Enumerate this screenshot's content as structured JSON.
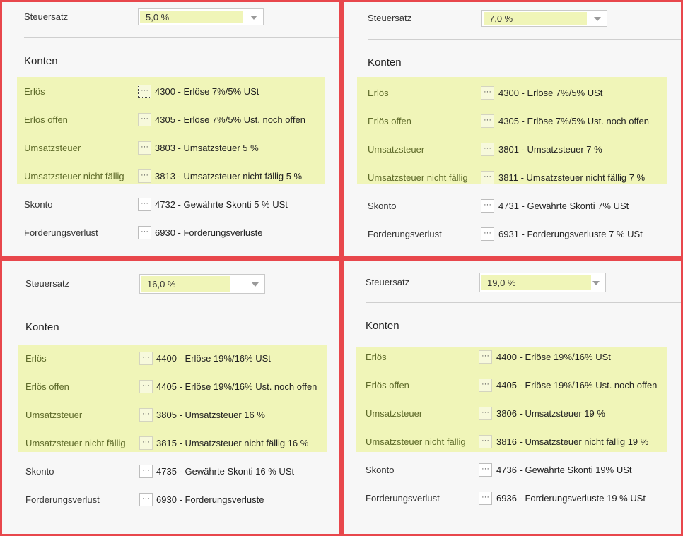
{
  "panels": [
    {
      "tax_label": "Steuersatz",
      "tax_rate": "5,0 %",
      "section_title": "Konten",
      "rows": [
        {
          "label": "Erlös",
          "account": "4300 - Erlöse 7%/5% USt"
        },
        {
          "label": "Erlös offen",
          "account": "4305 - Erlöse 7%/5% Ust. noch offen"
        },
        {
          "label": "Umsatzsteuer",
          "account": "3803 - Umsatzsteuer 5 %"
        },
        {
          "label": "Umsatzsteuer nicht fällig",
          "account": "3813 - Umsatzsteuer nicht fällig 5 %"
        },
        {
          "label": "Skonto",
          "account": "4732 - Gewährte Skonti 5 % USt"
        },
        {
          "label": "Forderungsverlust",
          "account": "6930 - Forderungsverluste"
        }
      ]
    },
    {
      "tax_label": "Steuersatz",
      "tax_rate": "7,0 %",
      "section_title": "Konten",
      "rows": [
        {
          "label": "Erlös",
          "account": "4300 - Erlöse 7%/5% USt"
        },
        {
          "label": "Erlös offen",
          "account": "4305 - Erlöse 7%/5% Ust. noch offen"
        },
        {
          "label": "Umsatzsteuer",
          "account": "3801 - Umsatzsteuer 7 %"
        },
        {
          "label": "Umsatzsteuer nicht fällig",
          "account": "3811 - Umsatzsteuer nicht fällig 7 %"
        },
        {
          "label": "Skonto",
          "account": "4731 - Gewährte Skonti 7% USt"
        },
        {
          "label": "Forderungsverlust",
          "account": "6931 - Forderungsverluste 7 % USt"
        }
      ]
    },
    {
      "tax_label": "Steuersatz",
      "tax_rate": "16,0 %",
      "section_title": "Konten",
      "rows": [
        {
          "label": "Erlös",
          "account": "4400 - Erlöse 19%/16% USt"
        },
        {
          "label": "Erlös offen",
          "account": "4405 - Erlöse 19%/16% Ust. noch offen"
        },
        {
          "label": "Umsatzsteuer",
          "account": "3805 - Umsatzsteuer 16 %"
        },
        {
          "label": "Umsatzsteuer nicht fällig",
          "account": "3815 - Umsatzsteuer nicht fällig 16 %"
        },
        {
          "label": "Skonto",
          "account": "4735 - Gewährte Skonti 16 % USt"
        },
        {
          "label": "Forderungsverlust",
          "account": "6930 - Forderungsverluste"
        }
      ]
    },
    {
      "tax_label": "Steuersatz",
      "tax_rate": "19,0 %",
      "section_title": "Konten",
      "rows": [
        {
          "label": "Erlös",
          "account": "4400 - Erlöse 19%/16% USt"
        },
        {
          "label": "Erlös offen",
          "account": "4405 - Erlöse 19%/16% Ust. noch offen"
        },
        {
          "label": "Umsatzsteuer",
          "account": "3806 - Umsatzsteuer 19 %"
        },
        {
          "label": "Umsatzsteuer nicht fällig",
          "account": "3816 - Umsatzsteuer nicht fällig 19 %"
        },
        {
          "label": "Skonto",
          "account": "4736 - Gewährte Skonti 19% USt"
        },
        {
          "label": "Forderungsverlust",
          "account": "6936 - Forderungsverluste 19 % USt"
        }
      ]
    }
  ],
  "ellipsis_glyph": "···",
  "colors": {
    "highlight": "#f0f5b8",
    "highlight_label": "#5f6b2a",
    "panel_border": "#e8474c"
  }
}
